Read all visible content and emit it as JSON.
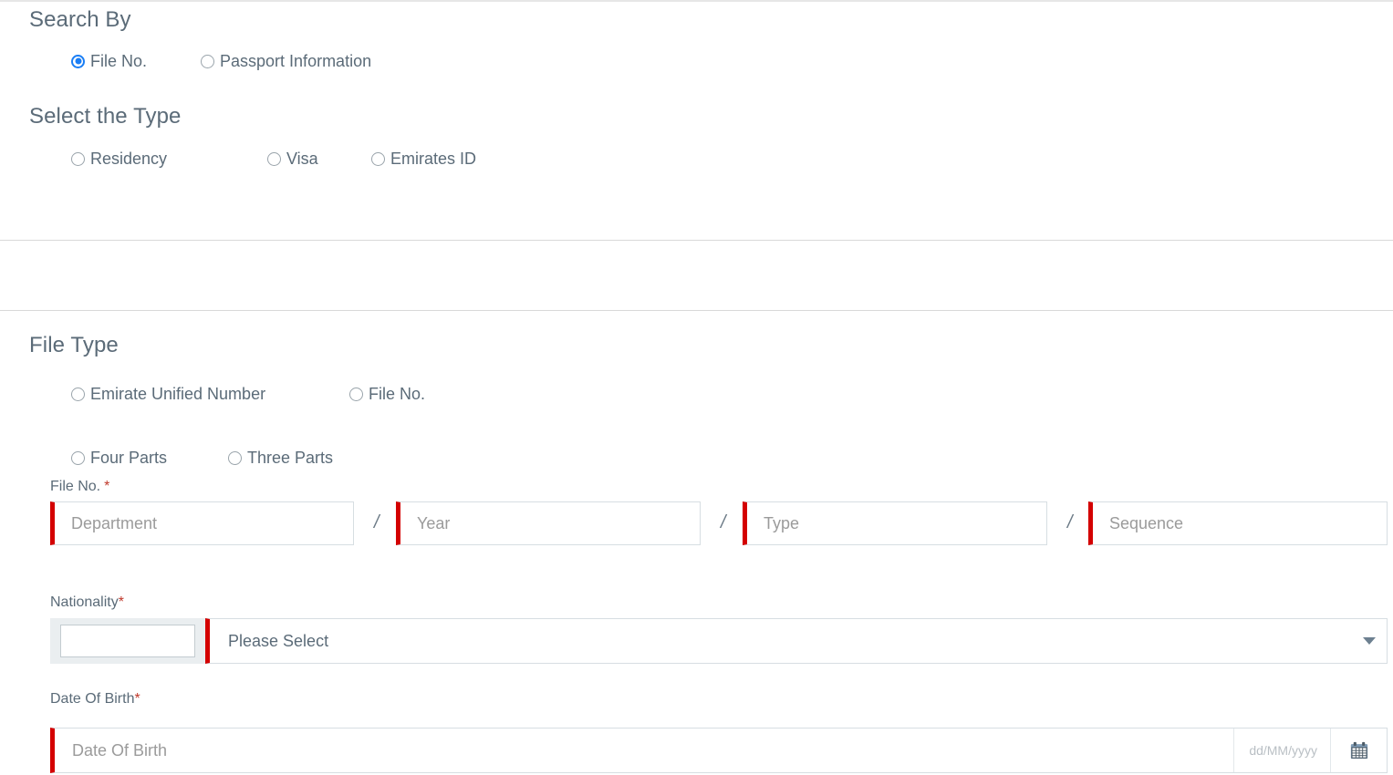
{
  "search_by": {
    "title": "Search By",
    "options": [
      {
        "label": "File No.",
        "selected": true
      },
      {
        "label": "Passport Information",
        "selected": false
      }
    ]
  },
  "select_type": {
    "title": "Select the Type",
    "options": [
      {
        "label": "Residency",
        "selected": false
      },
      {
        "label": "Visa",
        "selected": true
      },
      {
        "label": "Emirates ID",
        "selected": false
      }
    ]
  },
  "file_type": {
    "title": "File Type",
    "options": [
      {
        "label": "Emirate Unified Number",
        "selected": false
      },
      {
        "label": "File No.",
        "selected": true
      }
    ],
    "parts_options": [
      {
        "label": "Four Parts",
        "selected": true
      },
      {
        "label": "Three Parts",
        "selected": false
      }
    ]
  },
  "file_no": {
    "label": "File No.",
    "required_mark": "*",
    "separator": "/",
    "fields": [
      {
        "name": "department",
        "placeholder": "Department",
        "value": ""
      },
      {
        "name": "year",
        "placeholder": "Year",
        "value": ""
      },
      {
        "name": "type",
        "placeholder": "Type",
        "value": ""
      },
      {
        "name": "sequence",
        "placeholder": "Sequence",
        "value": ""
      }
    ]
  },
  "nationality": {
    "label": "Nationality",
    "required_mark": "*",
    "code_value": "",
    "selected_option": "Please Select",
    "caret_icon": "chevron-down-icon"
  },
  "date_of_birth": {
    "label": "Date Of Birth",
    "required_mark": "*",
    "placeholder": "Date Of Birth",
    "value": "",
    "format_hint": "dd/MM/yyyy",
    "calendar_icon": "calendar-icon"
  },
  "colors": {
    "accent_blue": "#1a7ef5",
    "required_red": "#d40000",
    "label_gray": "#5b6b78",
    "placeholder_gray": "#9b9b9b",
    "panel_gray": "#eaeef0",
    "border_gray": "#d7dee2"
  }
}
